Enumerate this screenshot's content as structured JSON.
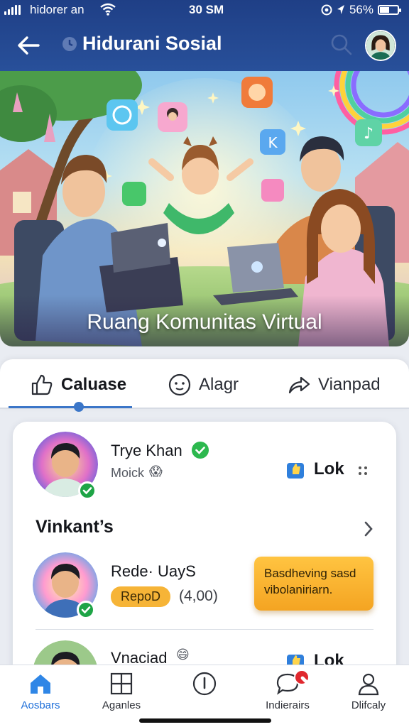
{
  "status_bar": {
    "carrier": "hidorer an",
    "time": "30 SM",
    "battery": "56%",
    "battery_level": 0.56
  },
  "header": {
    "title": "Hidurani Sosial",
    "back_icon": "arrow-left-icon",
    "search_icon": "search-icon"
  },
  "hero": {
    "title": "Ruang Komunitas Virtual"
  },
  "tabs": [
    {
      "label": "Caluase",
      "icon": "thumbs-up-icon",
      "active": true
    },
    {
      "label": "Alagr",
      "icon": "smiley-icon",
      "active": false
    },
    {
      "label": "Vianpad",
      "icon": "share-icon",
      "active": false
    }
  ],
  "post": {
    "name": "Trye Khan",
    "sub": "Moick",
    "sub_emoji": "😱",
    "action_label": "Lok"
  },
  "section": {
    "title": "Vinkant’s"
  },
  "item1": {
    "name": "Rede· UayS",
    "badge": "RepoD",
    "count": "(4,00)",
    "promo": "Basdheving sasd vibolaniriarn."
  },
  "item2": {
    "name": "Vnaciad",
    "emoji": "😄",
    "action_label": "Lok"
  },
  "bottom_nav": [
    {
      "label": "Aosbars",
      "icon": "home-icon",
      "active": true
    },
    {
      "label": "Aganles",
      "icon": "grid-icon",
      "active": false
    },
    {
      "label": "",
      "icon": "info-circle-icon",
      "active": false
    },
    {
      "label": "Indierairs",
      "icon": "chat-bubble-icon",
      "active": false
    },
    {
      "label": "Dlifcaly",
      "icon": "profile-icon",
      "active": false
    }
  ],
  "colors": {
    "header_bg": "#28509a",
    "accent": "#1e6fd9",
    "verified": "#1ea446",
    "badge": "#f6b437",
    "notification": "#e0282e"
  }
}
